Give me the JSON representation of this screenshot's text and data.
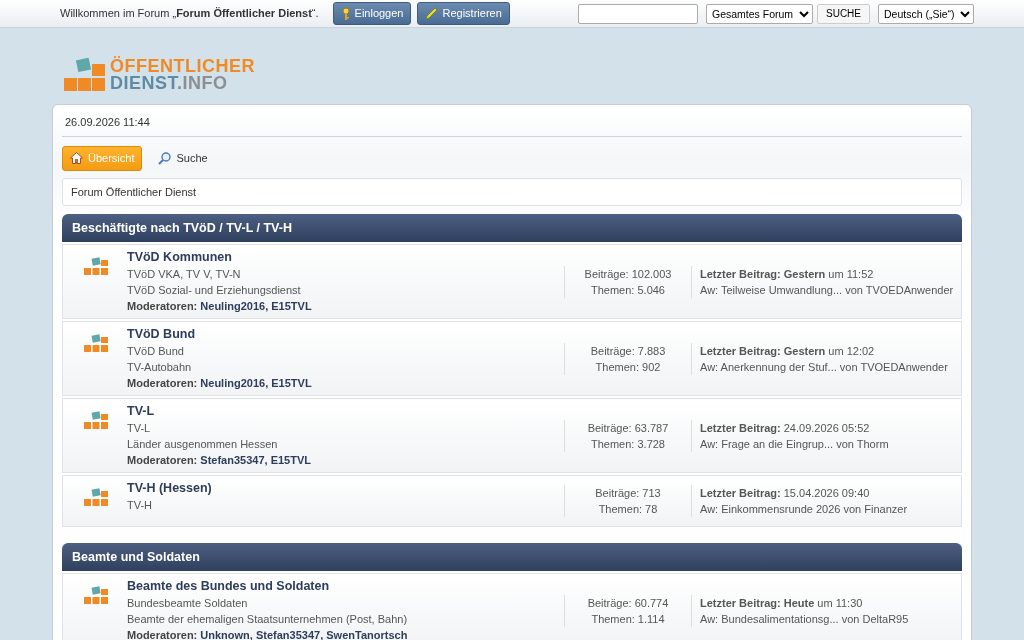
{
  "topbar": {
    "welcome": "Willkommen im Forum „**Forum Öffentlicher Dienst**“.",
    "buttons": [
      {
        "kind": "login",
        "label": "Einloggen"
      },
      {
        "kind": "register",
        "label": "Registrieren"
      }
    ],
    "search": {
      "scope": "Gesamtes Forum",
      "button": "SUCHE"
    },
    "language": "Deutsch („Sie“)"
  },
  "logo": {
    "line1": "ÖFFENTLICHER",
    "line2": "DIENST",
    "line2_suffix": ".INFO"
  },
  "date": "26.09.2026 11:44",
  "nav": [
    {
      "kind": "home",
      "label": "Übersicht",
      "selected": true
    },
    {
      "kind": "search",
      "label": "Suche",
      "selected": false
    }
  ],
  "breadcrumb": "Forum Öffentlicher Dienst",
  "categories": [
    {
      "title": "Beschäftigte nach TVöD / TV-L / TV-H",
      "boards": [
        {
          "name": "TVöD Kommunen",
          "lines": [
            "TVöD VKA, TV V, TV-N",
            "TVöD Sozial- und Erziehungsdienst"
          ],
          "moderators_label": "Moderatoren:",
          "moderators": "Neuling2016, E15TVL",
          "posts": "Beiträge: 102.003",
          "topics": "Themen: 5.046",
          "last": "**Letzter Beitrag: Gestern** um 11:52",
          "topic": "Aw: Teilweise Umwandlung...",
          "by": "von",
          "author": "TVOEDAnwender"
        },
        {
          "name": "TVöD Bund",
          "lines": [
            "TVöD Bund",
            "TV-Autobahn"
          ],
          "moderators_label": "Moderatoren:",
          "moderators": "Neuling2016, E15TVL",
          "posts": "Beiträge: 7.883",
          "topics": "Themen: 902",
          "last": "**Letzter Beitrag: Gestern** um 12:02",
          "topic": "Aw: Anerkennung der Stuf...",
          "by": "von",
          "author": "TVOEDAnwender"
        },
        {
          "name": "TV-L",
          "lines": [
            "TV-L",
            "Länder ausgenommen Hessen"
          ],
          "moderators_label": "Moderatoren:",
          "moderators": "Stefan35347, E15TVL",
          "posts": "Beiträge: 63.787",
          "topics": "Themen: 3.728",
          "last": "**Letzter Beitrag:** 24.09.2026 05:52",
          "topic": "Aw: Frage an die Eingrup...",
          "by": "von",
          "author": "Thorm"
        },
        {
          "name": "TV-H (Hessen)",
          "lines": [
            "TV-H"
          ],
          "posts": "Beiträge: 713",
          "topics": "Themen: 78",
          "last": "**Letzter Beitrag:** 15.04.2026 09:40",
          "topic": "Aw: Einkommensrunde 2026",
          "by": "von",
          "author": "Finanzer"
        }
      ]
    },
    {
      "title": "Beamte und Soldaten",
      "boards": [
        {
          "name": "Beamte des Bundes und Soldaten",
          "lines": [
            "Bundesbeamte Soldaten",
            "Beamte der ehemaligen Staatsunternehmen (Post, Bahn)"
          ],
          "moderators_label": "Moderatoren:",
          "moderators": "Unknown, Stefan35347, SwenTanortsch",
          "posts": "Beiträge: 60.774",
          "topics": "Themen: 1.114",
          "last": "**Letzter Beitrag: Heute** um 11:30",
          "topic": "Aw: Bundesalimentationsg...",
          "by": "von",
          "author": "DeltaR95"
        }
      ]
    }
  ]
}
